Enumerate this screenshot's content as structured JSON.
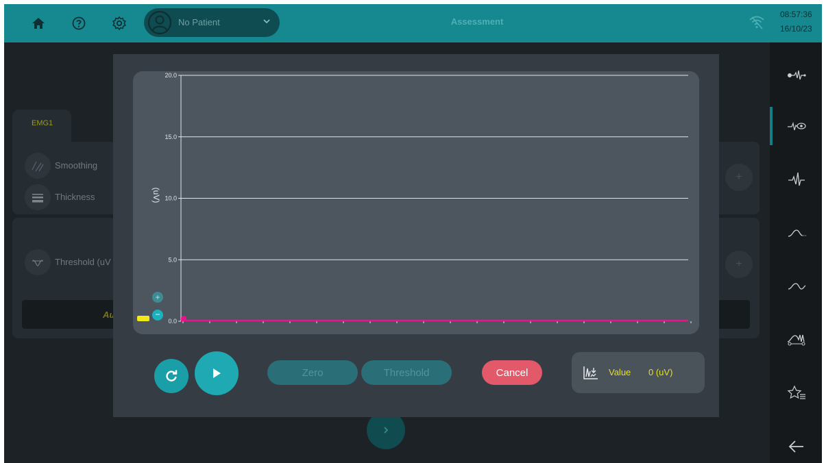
{
  "topbar": {
    "patient": "No Patient",
    "title": "Assessment",
    "time": "08:57:36",
    "date": "16/10/23",
    "icons": [
      "home-icon",
      "help-icon",
      "settings-icon",
      "user-icon",
      "chevron-down-icon",
      "wifi-icon"
    ]
  },
  "sidebar": {
    "icons": [
      "emg-probe-icon",
      "emg-view-icon",
      "emg-signal-icon",
      "curve-icon",
      "wave-icon",
      "trigger-icon",
      "favorites-icon",
      "back-arrow-icon"
    ]
  },
  "background": {
    "tab": "EMG1",
    "rows": {
      "smoothing": "Smoothing",
      "thickness": "Thickness",
      "threshold": "Threshold (uV"
    },
    "auto_label": "Au",
    "plus_label": "+"
  },
  "modal": {
    "chart_axis_label": "(uV)",
    "zoom_in": "+",
    "zoom_out": "−",
    "buttons": {
      "zero": "Zero",
      "threshold": "Threshold",
      "cancel": "Cancel"
    },
    "value": {
      "label": "Value",
      "reading": "0 (uV)"
    }
  },
  "colors": {
    "accent": "#15898f",
    "signal": "#e8148c",
    "value_text": "#e4e21c",
    "cancel": "#e2596a"
  },
  "chart_data": {
    "type": "line",
    "title": "",
    "xlabel": "",
    "ylabel": "(uV)",
    "ylim": [
      0,
      20
    ],
    "yticks": [
      "20.0",
      "15.0",
      "10.0",
      "5.0",
      "0.0"
    ],
    "grid": true,
    "series": [
      {
        "x": [
          0,
          1
        ],
        "values": [
          0,
          0
        ]
      }
    ]
  }
}
